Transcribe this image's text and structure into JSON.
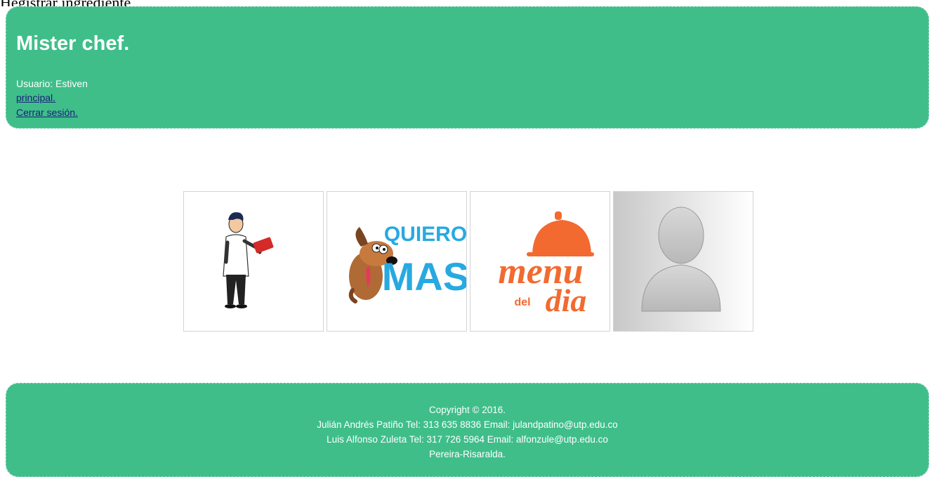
{
  "page_top_text": "Hegistrar ingrediente",
  "header": {
    "title": "Mister chef.",
    "user_line": "Usuario: Estiven",
    "links": {
      "principal": "principal.",
      "logout": "Cerrar sesión."
    }
  },
  "tiles": [
    {
      "name": "waiter-tile",
      "icon": "waiter-taking-order-illustration"
    },
    {
      "name": "quiero-mas-tile",
      "icon": "dog-quiero-mas-logo",
      "logo_text": [
        "QUIERO",
        "MAS"
      ]
    },
    {
      "name": "menu-del-dia-tile",
      "icon": "menu-del-dia-logo",
      "logo_text": [
        "menu",
        "del",
        "dia"
      ]
    },
    {
      "name": "profile-tile",
      "icon": "user-avatar-placeholder"
    }
  ],
  "footer": {
    "lines": [
      "Copyright © 2016.",
      "Julián Andrés Patiño Tel: 313 635 8836 Email: julandpatino@utp.edu.co",
      "Luis Alfonso Zuleta Tel: 317 726 5964 Email: alfonzule@utp.edu.co",
      "Pereira-Risaralda."
    ]
  },
  "colors": {
    "panel": "#3fbe8a",
    "link": "#1a1f7a",
    "menu_orange": "#f26a30",
    "quiero_blue": "#27a9e1"
  }
}
